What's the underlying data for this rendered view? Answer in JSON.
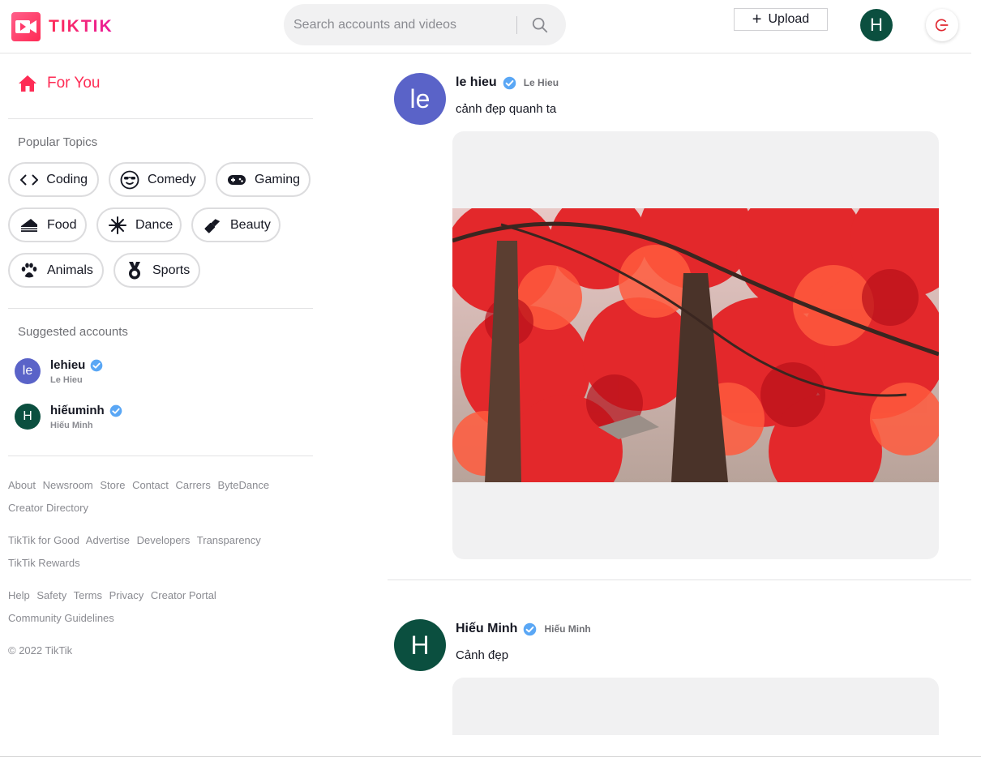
{
  "brand": {
    "name": "TIKTIK",
    "color": "#fe2c55"
  },
  "search": {
    "placeholder": "Search accounts and videos"
  },
  "header": {
    "upload_label": "Upload",
    "avatar_initial": "H"
  },
  "sidebar": {
    "for_you": "For You",
    "popular_topics_title": "Popular Topics",
    "topics": [
      {
        "label": "Coding",
        "icon": "code-icon"
      },
      {
        "label": "Comedy",
        "icon": "sunglasses-face-icon"
      },
      {
        "label": "Gaming",
        "icon": "gamepad-icon"
      },
      {
        "label": "Food",
        "icon": "cake-icon"
      },
      {
        "label": "Dance",
        "icon": "dance-icon"
      },
      {
        "label": "Beauty",
        "icon": "lipstick-icon"
      },
      {
        "label": "Animals",
        "icon": "paw-icon"
      },
      {
        "label": "Sports",
        "icon": "medal-icon"
      }
    ],
    "suggested_title": "Suggested accounts",
    "accounts": [
      {
        "initial": "le",
        "username": "lehieu",
        "display_name": "Le Hieu",
        "color": "#5a63c8"
      },
      {
        "initial": "H",
        "username": "hiếuminh",
        "display_name": "Hiếu Minh",
        "color": "#0b4f3f"
      }
    ],
    "footer": {
      "row1": [
        "About",
        "Newsroom",
        "Store",
        "Contact",
        "Carrers",
        "ByteDance"
      ],
      "row1b": "Creator Directory",
      "row2": [
        "TikTik for Good",
        "Advertise",
        "Developers",
        "Transparency"
      ],
      "row2b": "TikTik Rewards",
      "row3": [
        "Help",
        "Safety",
        "Terms",
        "Privacy",
        "Creator Portal"
      ],
      "row3b": "Community Guidelines",
      "copyright": "© 2022 TikTik"
    }
  },
  "feed": {
    "posts": [
      {
        "initial": "le",
        "username": "le hieu",
        "display_name": "Le Hieu",
        "caption": "cảnh đẹp quanh ta",
        "color": "#5a63c8"
      },
      {
        "initial": "H",
        "username": "Hiếu Minh",
        "display_name": "Hiếu Minh",
        "caption": "Cảnh đẹp",
        "color": "#0b4f3f"
      }
    ]
  },
  "colors": {
    "verified": "#20a4f3",
    "accent": "#fe2c55"
  }
}
